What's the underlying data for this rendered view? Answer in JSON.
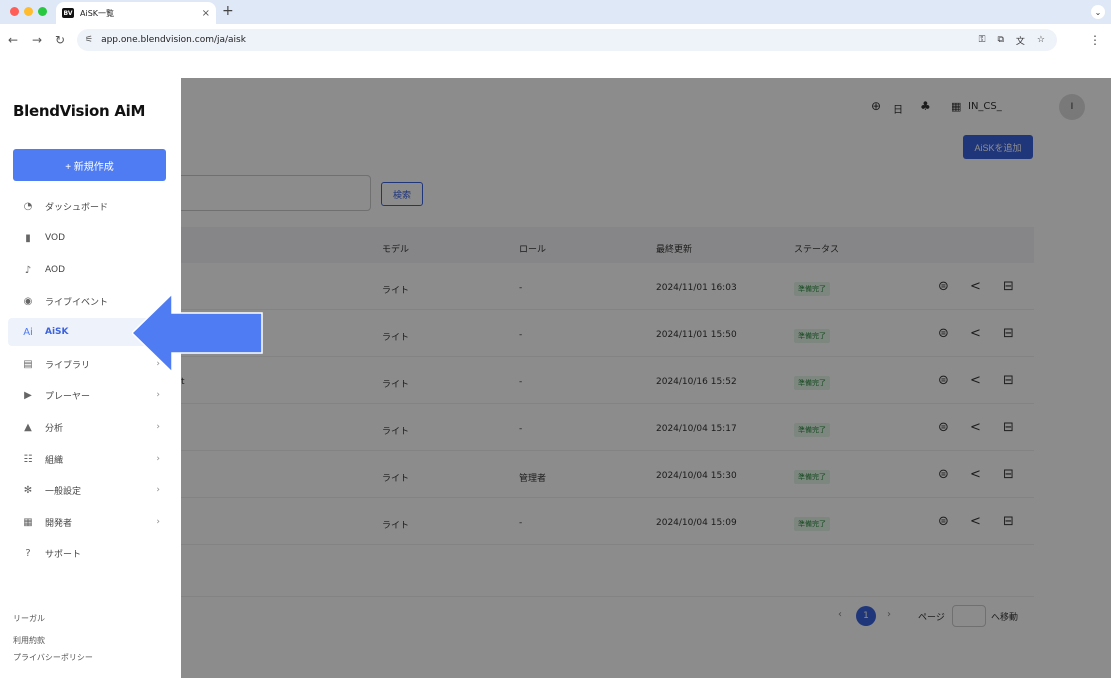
{
  "browser": {
    "tab_title": "AiSK一覧",
    "favicon_text": "BV",
    "url": "app.one.blendvision.com/ja/aisk"
  },
  "header": {
    "lang": "日",
    "org": "IN_CS_",
    "avatar": "I",
    "add_button": "AiSKを追加",
    "search_button": "検索"
  },
  "sidebar": {
    "brand": "BlendVision AiM",
    "new_button": "+ 新規作成",
    "items": [
      {
        "label": "ダッシュボード",
        "icon": "◔",
        "chev": false
      },
      {
        "label": "VOD",
        "icon": "▮",
        "chev": false
      },
      {
        "label": "AOD",
        "icon": "♪",
        "chev": false
      },
      {
        "label": "ライブイベント",
        "icon": "◉",
        "chev": false
      },
      {
        "label": "AiSK",
        "icon": "Ai",
        "chev": false,
        "active": true
      },
      {
        "label": "ライブラリ",
        "icon": "▤",
        "chev": true
      },
      {
        "label": "プレーヤー",
        "icon": "▶",
        "chev": true
      },
      {
        "label": "分析",
        "icon": "▲",
        "chev": true
      },
      {
        "label": "組織",
        "icon": "☷",
        "chev": true
      },
      {
        "label": "一般設定",
        "icon": "✻",
        "chev": true
      },
      {
        "label": "開発者",
        "icon": "▦",
        "chev": true
      },
      {
        "label": "サポート",
        "icon": "?",
        "chev": false
      }
    ],
    "footer": [
      "リーガル",
      "利用約款",
      "プライバシーポリシー"
    ]
  },
  "table": {
    "headers": [
      "モデル",
      "ロール",
      "最終更新",
      "ステータス"
    ],
    "rows": [
      {
        "prefix": "",
        "model": "ライト",
        "role": "-",
        "updated": "2024/11/01 16:03",
        "status": "準備完了"
      },
      {
        "prefix": "",
        "model": "ライト",
        "role": "-",
        "updated": "2024/11/01 15:50",
        "status": "準備完了"
      },
      {
        "prefix": "t",
        "model": "ライト",
        "role": "-",
        "updated": "2024/10/16 15:52",
        "status": "準備完了"
      },
      {
        "prefix": "",
        "model": "ライト",
        "role": "-",
        "updated": "2024/10/04 15:17",
        "status": "準備完了"
      },
      {
        "prefix": "",
        "model": "ライト",
        "role": "管理者",
        "updated": "2024/10/04 15:30",
        "status": "準備完了"
      },
      {
        "prefix": "",
        "model": "ライト",
        "role": "-",
        "updated": "2024/10/04 15:09",
        "status": "準備完了"
      }
    ]
  },
  "pagination": {
    "current": "1",
    "page_label": "ページ",
    "go_label": "へ移動"
  },
  "colors": {
    "accent": "#3b63e0",
    "new_button": "#4f7cf3",
    "status_ready": "#2b8a3e",
    "callout": "#4f7cf3"
  }
}
